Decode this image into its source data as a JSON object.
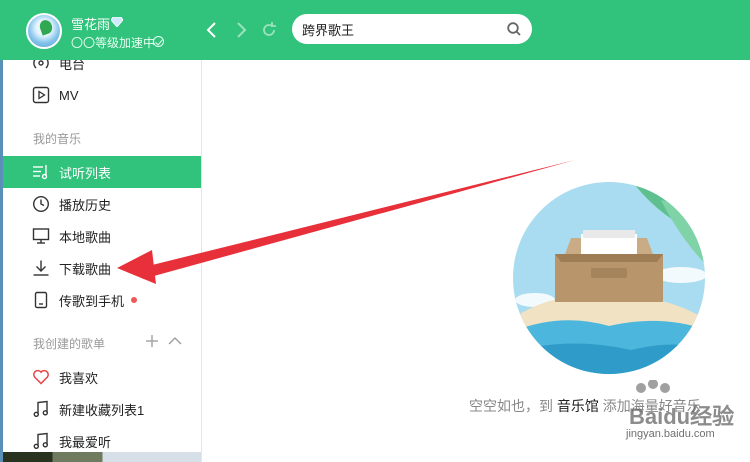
{
  "header": {
    "username": "雪花雨",
    "level_text": "〇〇等级加速中",
    "search": {
      "value": "跨界歌王",
      "placeholder": ""
    },
    "icons": {
      "back": "chevron-left-icon",
      "forward": "chevron-right-icon",
      "refresh": "refresh-icon",
      "search": "search-icon",
      "vip": "diamond-icon",
      "badge": "check-badge-icon"
    }
  },
  "sidebar": {
    "top_items": [
      {
        "label": "电台",
        "icon": "radio-icon"
      },
      {
        "label": "MV",
        "icon": "play-box-icon"
      }
    ],
    "my_music_title": "我的音乐",
    "my_music_items": [
      {
        "label": "试听列表",
        "icon": "music-list-icon",
        "active": true
      },
      {
        "label": "播放历史",
        "icon": "clock-icon"
      },
      {
        "label": "本地歌曲",
        "icon": "monitor-icon"
      },
      {
        "label": "下载歌曲",
        "icon": "download-icon"
      },
      {
        "label": "传歌到手机",
        "icon": "phone-icon",
        "badge": "red-dot"
      }
    ],
    "created_title": "我创建的歌单",
    "created_items": [
      {
        "label": "我喜欢",
        "icon": "heart-icon"
      },
      {
        "label": "新建收藏列表1",
        "icon": "music-note-icon"
      },
      {
        "label": "我最爱听",
        "icon": "music-note-icon"
      }
    ]
  },
  "main": {
    "empty_prefix": "空空如也，到",
    "empty_link": "音乐馆",
    "empty_suffix": "添加海量好音乐"
  },
  "watermark": {
    "logo_text": "Baidu经验",
    "url": "jingyan.baidu.com"
  },
  "colors": {
    "accent": "#31c27c",
    "arrow": "#e8303a",
    "badge": "#f25656"
  }
}
